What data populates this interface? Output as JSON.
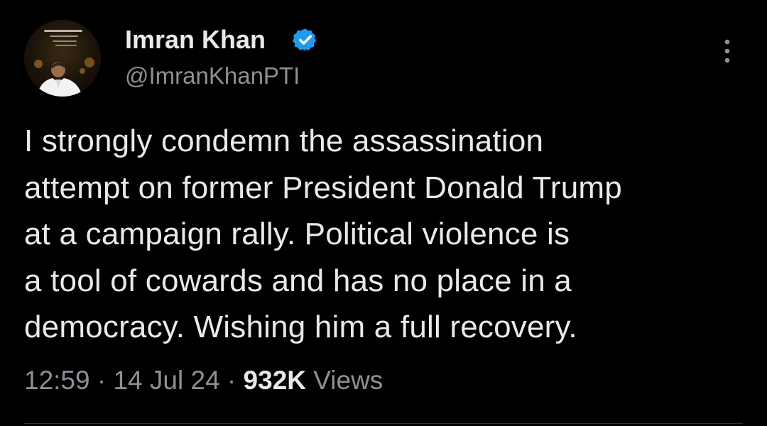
{
  "author": {
    "name": "Imran Khan",
    "handle": "@ImranKhanPTI",
    "verified": true,
    "avatar_icon": "profile-photo"
  },
  "tweet": {
    "text": "I strongly condemn the assassination\nattempt on former President Donald Trump\nat a campaign rally. Political violence is\na tool of cowards and has no place in a\ndemocracy. Wishing him a full recovery."
  },
  "meta": {
    "time": "12:59",
    "separator": " · ",
    "date": "14 Jul 24",
    "views_count": "932K",
    "views_label": "Views"
  },
  "icons": {
    "verified": "verified-badge-icon",
    "more": "more-options-icon"
  },
  "colors": {
    "background": "#000000",
    "text_primary": "#e7e9ea",
    "text_secondary": "#8b9196",
    "verified_blue": "#1d9bf0"
  }
}
